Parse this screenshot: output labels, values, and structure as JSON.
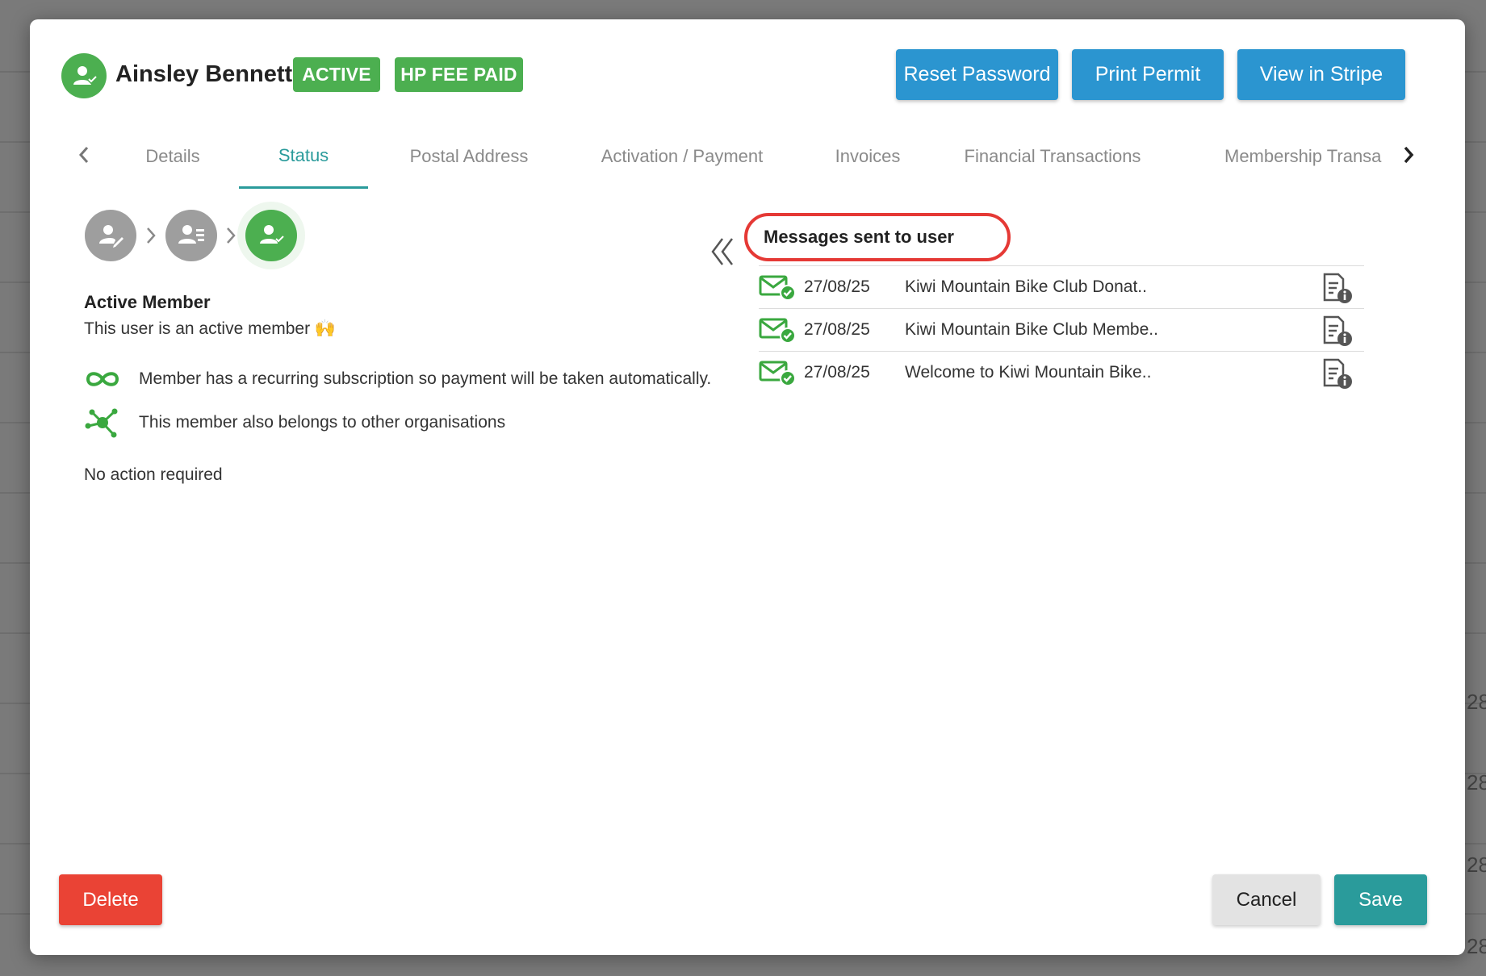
{
  "background": {
    "right_edge_values": [
      "28,",
      "28,",
      "28,",
      "28,"
    ]
  },
  "header": {
    "user_name": "Ainsley Bennett",
    "badges": [
      "ACTIVE",
      "HP FEE PAID"
    ],
    "buttons": {
      "reset_password": "Reset Password",
      "print_permit": "Print Permit",
      "view_in_stripe": "View in Stripe"
    }
  },
  "tabs": {
    "items": [
      "Details",
      "Status",
      "Postal Address",
      "Activation / Payment",
      "Invoices",
      "Financial Transactions",
      "Membership Transa"
    ],
    "active": "Status"
  },
  "status": {
    "title": "Active Member",
    "description": "This user is an active member 🙌",
    "recurring_note": "Member has a recurring subscription so payment will be taken automatically.",
    "other_orgs_note": "This member also belongs to other organisations",
    "action": "No action required"
  },
  "messages": {
    "header": "Messages sent to user",
    "rows": [
      {
        "date": "27/08/25",
        "subject": "Kiwi Mountain Bike Club Donat.."
      },
      {
        "date": "27/08/25",
        "subject": "Kiwi Mountain Bike Club Membe.."
      },
      {
        "date": "27/08/25",
        "subject": "Welcome to Kiwi Mountain Bike.."
      }
    ]
  },
  "footer": {
    "delete": "Delete",
    "cancel": "Cancel",
    "save": "Save"
  },
  "colors": {
    "accent_teal": "#2a9b9b",
    "button_blue": "#2b95d0",
    "success_green": "#4caf50",
    "danger_red": "#ea4335",
    "highlight_ring": "#e53935"
  },
  "icons": [
    "user-check-icon",
    "user-edit-icon",
    "user-card-icon",
    "chevron-left-icon",
    "chevron-right-icon",
    "infinity-icon",
    "network-icon",
    "double-chevron-left-icon",
    "mail-check-icon",
    "document-info-icon"
  ]
}
